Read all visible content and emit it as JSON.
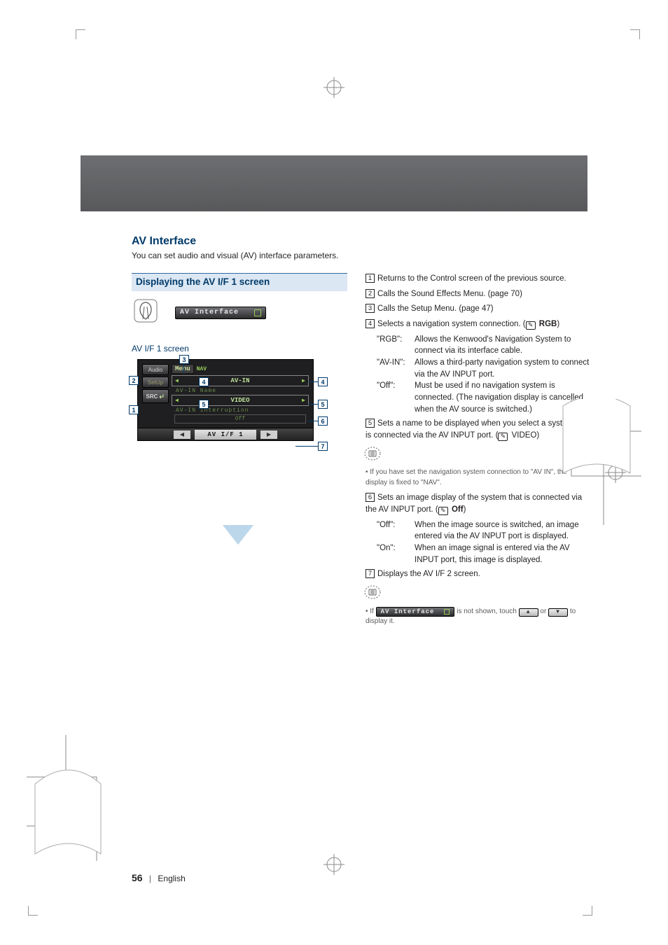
{
  "section": {
    "title": "AV Interface",
    "subtitle": "You can set audio and visual (AV) interface parameters."
  },
  "leftcol": {
    "block_title": "Displaying the AV I/F 1 screen",
    "pill_av_interface": "AV Interface",
    "screen_label": "AV I/F 1 screen",
    "device": {
      "menu_label": "Menu",
      "side_audio": "Audio",
      "side_setup": "SetUp",
      "side_src": "SRC",
      "nav_top_label": "NAV",
      "nav_value": "AV-IN",
      "avin_name_label": "AV-IN Name",
      "avin_name_value": "VIDEO",
      "interruption_label": "AV-IN Interruption",
      "interruption_value": "Off",
      "footer_tab": "AV I/F 1"
    },
    "callouts": {
      "c1": "1",
      "c2": "2",
      "c3": "3",
      "c4": "4",
      "c5": "5",
      "c6": "6",
      "c7": "7"
    }
  },
  "rightcol": {
    "n1": "1",
    "t1": "Returns to the Control screen of the previous source.",
    "n2": "2",
    "t2": "Calls the Sound Effects Menu. (page 70)",
    "n3": "3",
    "t3": "Calls the Setup Menu. (page 47)",
    "n4": "4",
    "t4_lead": "Selects a navigation system connection. (",
    "t4_flag": "RGB",
    "t4_close": ")",
    "t4_rgb_key": "\"RGB\":",
    "t4_rgb_val": "Allows the Kenwood's Navigation System to connect via its interface cable.",
    "t4_avin_key": "\"AV-IN\":",
    "t4_avin_val": "Allows a third-party navigation system to connect via the AV INPUT port.",
    "t4_off_key": "\"Off\":",
    "t4_off_val": "Must be used if no navigation system is connected. (The navigation display is cancelled when the AV source is switched.)",
    "n5": "5",
    "t5_a": "Sets a name to be displayed when you select a system that is connected via the AV INPUT port. (",
    "t5_flag": "VIDEO",
    "t5_b": ")",
    "note1": "If you have set the navigation system connection to \"AV IN\", the display is fixed to \"NAV\".",
    "n6": "6",
    "t6_lead": "Sets an image display of the system that is connected via the AV INPUT port. (",
    "t6_flag": "Off",
    "t6_close": ")",
    "t6_off_key": "\"Off\":",
    "t6_off_val": "When the image source is switched, an image entered via the AV INPUT port is displayed.",
    "t6_on_key": "\"On\":",
    "t6_on_val": "When an image signal is entered via the AV INPUT port, this image is displayed.",
    "n7": "7",
    "t7": "Displays the AV I/F 2 screen.",
    "note2_a": "If ",
    "note2_pill": "AV Interface",
    "note2_b": " is not shown, touch ",
    "note2_c": " or ",
    "note2_d": " to display it."
  },
  "footer": {
    "page": "56",
    "lang": "English"
  }
}
